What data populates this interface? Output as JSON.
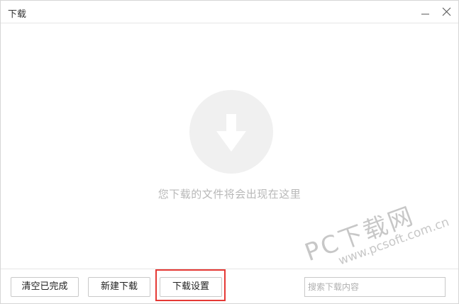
{
  "window": {
    "title": "下载"
  },
  "title_controls": {
    "minimize_icon": "minimize-icon",
    "close_icon": "close-icon"
  },
  "empty_state": {
    "icon": "download-arrow-icon",
    "message": "您下载的文件将会出现在这里"
  },
  "footer": {
    "clear_completed_label": "清空已完成",
    "new_download_label": "新建下载",
    "download_settings_label": "下载设置",
    "search_placeholder": "搜索下载内容",
    "highlight_color": "#e53935"
  },
  "watermark": {
    "title": "PC下载网",
    "site": "www.pcsoft.com.cn"
  },
  "colors": {
    "icon_circle": "#f0f0f0",
    "empty_text": "#b8b8b8",
    "border": "#c9c9c9"
  }
}
